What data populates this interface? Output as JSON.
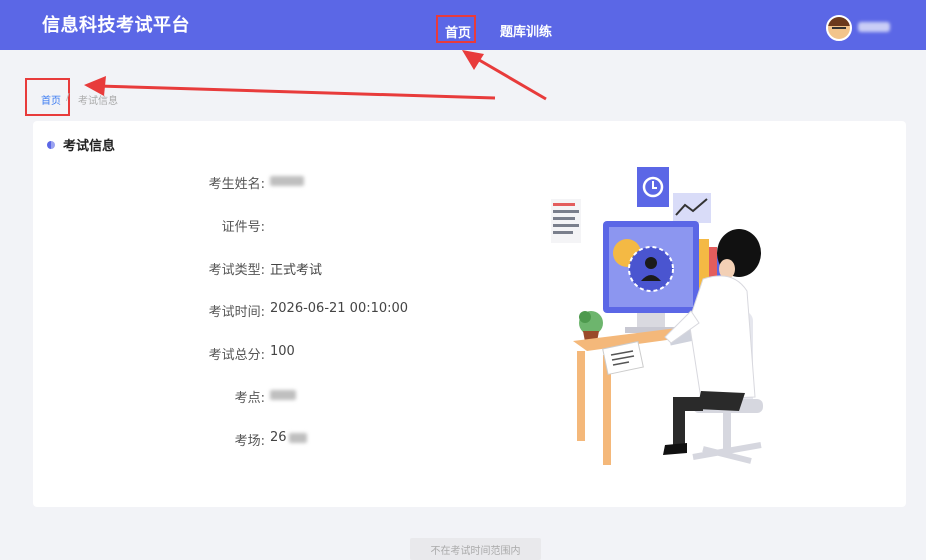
{
  "header": {
    "brand": "信息科技考试平台",
    "nav": [
      {
        "label": "首页",
        "active": true
      },
      {
        "label": "题库训练",
        "active": false
      }
    ]
  },
  "breadcrumb": {
    "home": "首页",
    "separator": "/",
    "current": "考试信息"
  },
  "card": {
    "title": "考试信息",
    "fields": [
      {
        "label": "考生姓名:",
        "value": ""
      },
      {
        "label": "证件号:",
        "value": ""
      },
      {
        "label": "考试类型:",
        "value": "正式考试"
      },
      {
        "label": "考试时间:",
        "value": "2026-06-21 00:10:00"
      },
      {
        "label": "考试总分:",
        "value": "100"
      },
      {
        "label": "考点:",
        "value": ""
      },
      {
        "label": "考场:",
        "value": "26"
      }
    ]
  },
  "footer": {
    "status_button": "不在考试时间范围内"
  },
  "colors": {
    "header_bg": "#5b67e6",
    "page_bg": "#f2f3f7",
    "annotation_red": "#e83b3b",
    "link_blue": "#3d7cf2"
  }
}
